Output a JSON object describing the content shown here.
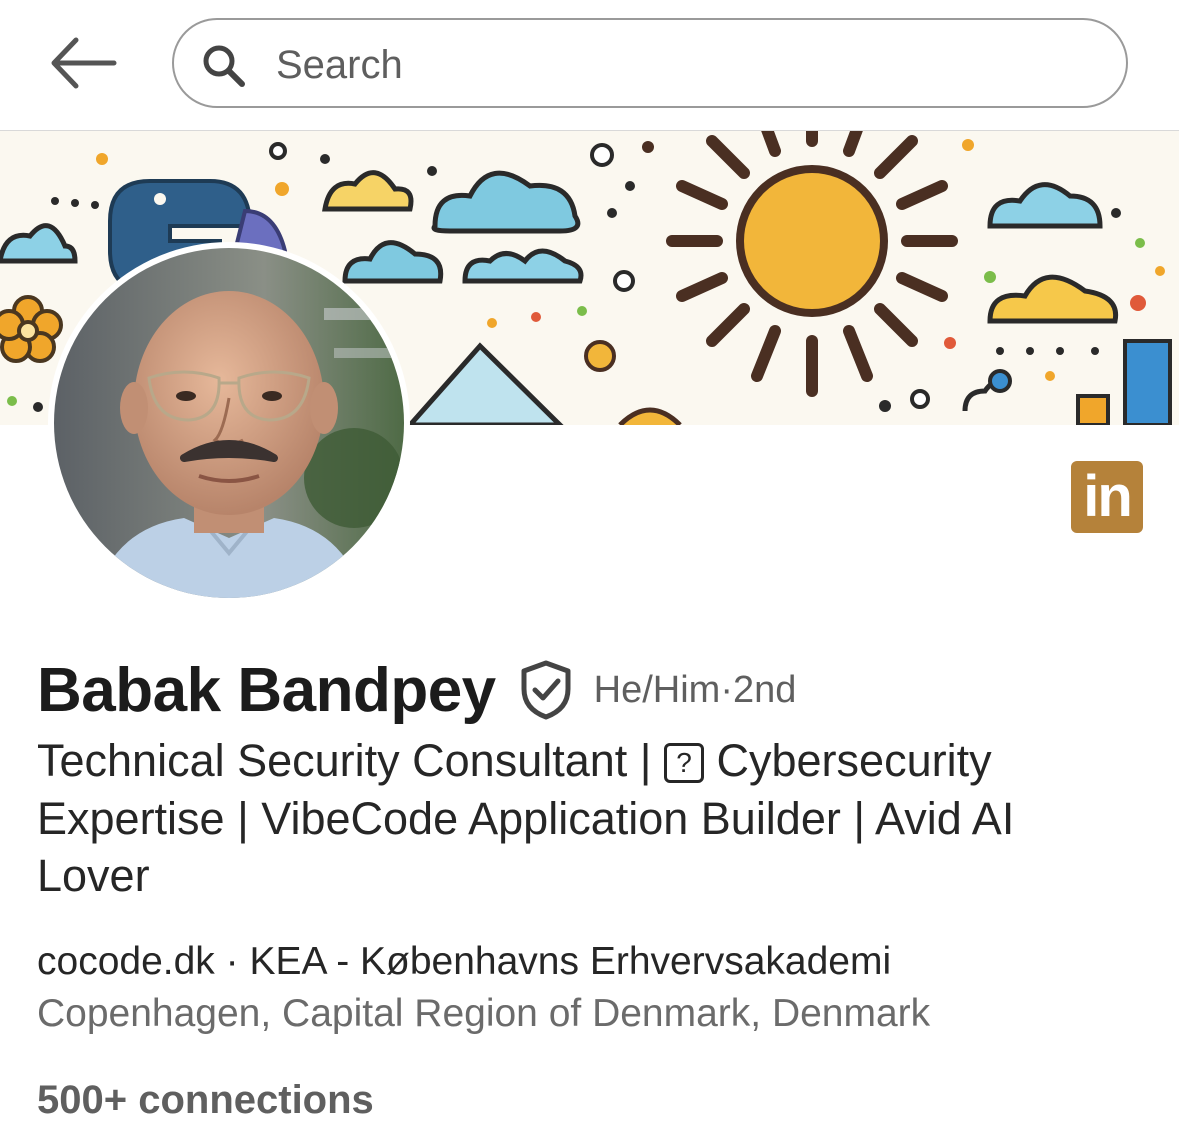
{
  "search": {
    "placeholder": "Search"
  },
  "profile": {
    "name": "Babak Bandpey",
    "pronouns": "He/Him",
    "degree_separator": " · ",
    "degree": "2nd",
    "headline_part1": "Technical Security Consultant | ",
    "headline_symbol": "?",
    "headline_part2": " Cybersecurity Expertise | VibeCode Application Builder | Avid AI Lover",
    "company": "cocode.dk",
    "company_separator": " · ",
    "school": "KEA - Københavns Erhvervsakademi",
    "location": "Copenhagen, Capital Region of Denmark, Denmark",
    "connections": "500+ connections",
    "linkedin_badge": "in"
  },
  "colors": {
    "linkedin_badge": "#b5823a",
    "sun": "#f2b63a",
    "cloud": "#7fc9e0",
    "python_blue": "#2f5f8a",
    "banner_bg": "#fbf8f0"
  },
  "icons": {
    "back": "arrow-left-icon",
    "search": "magnifier-icon",
    "verified": "shield-check-icon"
  }
}
